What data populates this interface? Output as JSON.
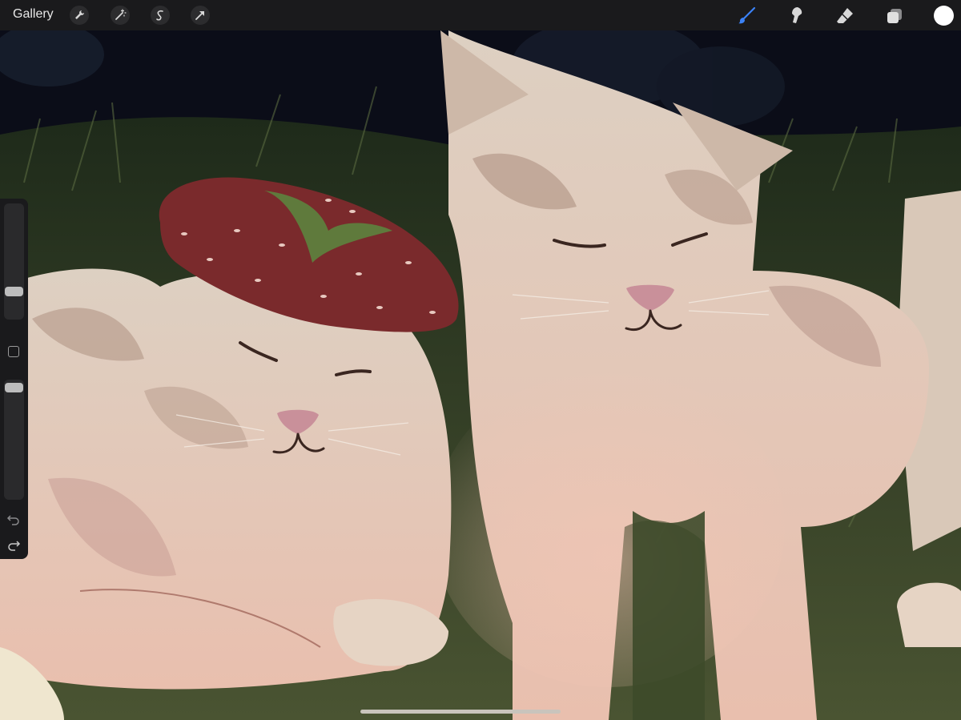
{
  "toolbar": {
    "gallery_label": "Gallery",
    "left_tools": [
      "wrench-icon",
      "magic-wand-icon",
      "selection-icon",
      "transform-arrow-icon"
    ],
    "right_tools": [
      "brush-icon",
      "smudge-icon",
      "eraser-icon",
      "layers-icon"
    ],
    "active_tool": "brush-icon",
    "current_color": "#ffffff",
    "accent_color": "#3b82f6"
  },
  "sidebar": {
    "brush_size_level": 0.22,
    "opacity_level": 0.97,
    "tools": [
      "modify-square-icon",
      "undo-icon",
      "redo-icon"
    ]
  },
  "canvas": {
    "palette": {
      "night": "#0b0d18",
      "grass": "#3d4a2a",
      "fur": "#e4d3c2",
      "fur_shadow": "#b59a8a",
      "blush": "#e9b8a6",
      "strawberry": "#7a2a2c",
      "leaf": "#5f7a3c",
      "nose": "#c9909a"
    }
  }
}
